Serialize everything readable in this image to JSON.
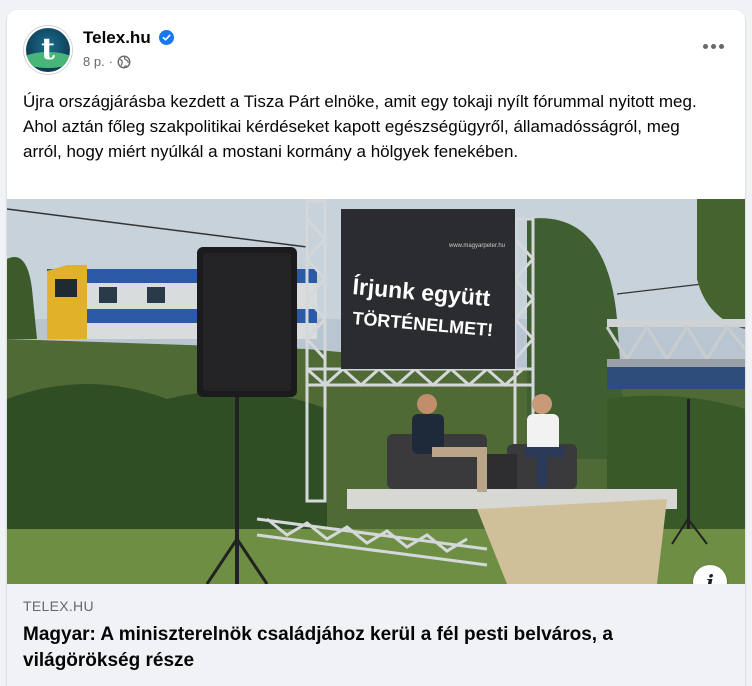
{
  "post": {
    "page_name": "Telex.hu",
    "avatar_letter": "t",
    "timestamp": "8 p.",
    "separator": "·",
    "text": "Újra országjárásba kezdett a Tisza Párt elnöke, amit egy tokaji nyílt fórummal nyitott meg. Ahol aztán főleg szakpolitikai kérdéseket kapott egészségügyről, államadósságról, meg arról, hogy miért nyúlkál a mostani kormány a hölgyek fenekében."
  },
  "photo": {
    "banner_url": "www.magyarpeter.hu",
    "banner_line1": "Írjunk együtt",
    "banner_line2": "TÖRTÉNELMET!"
  },
  "link_preview": {
    "domain": "TELEX.HU",
    "headline": "Magyar: A miniszterelnök családjához kerül a fél pesti belváros, a világörökség része",
    "info_glyph": "i"
  },
  "icons": {
    "verified": "verified-badge-icon",
    "audience": "globe-icon",
    "more": "more-options-icon",
    "info": "info-icon"
  },
  "colors": {
    "verified_blue": "#1877f2",
    "secondary_text": "#65676b",
    "link_box_bg": "#f0f2f5"
  }
}
